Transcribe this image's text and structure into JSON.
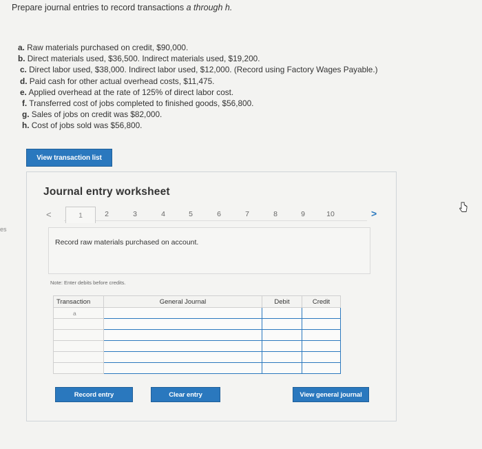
{
  "prompt": {
    "text": "Prepare journal entries to record transactions",
    "range": "a through h."
  },
  "left_edge_text": "es",
  "transactions": [
    {
      "letter": "a.",
      "text": "Raw materials purchased on credit, $90,000."
    },
    {
      "letter": "b.",
      "text": "Direct materials used, $36,500. Indirect materials used, $19,200."
    },
    {
      "letter": "c.",
      "text": "Direct labor used, $38,000. Indirect labor used, $12,000. (Record using Factory Wages Payable.)"
    },
    {
      "letter": "d.",
      "text": "Paid cash for other actual overhead costs, $11,475."
    },
    {
      "letter": "e.",
      "text": "Applied overhead at the rate of 125% of direct labor cost."
    },
    {
      "letter": "f.",
      "text": "Transferred cost of jobs completed to finished goods, $56,800."
    },
    {
      "letter": "g.",
      "text": "Sales of jobs on credit was $82,000."
    },
    {
      "letter": "h.",
      "text": "Cost of jobs sold was $56,800."
    }
  ],
  "buttons": {
    "view_transaction_list": "View transaction list",
    "record_entry": "Record entry",
    "clear_entry": "Clear entry",
    "view_general_journal": "View general journal"
  },
  "worksheet": {
    "title": "Journal entry worksheet",
    "nav_prev": "<",
    "nav_next": ">",
    "pages": [
      "1",
      "2",
      "3",
      "4",
      "5",
      "6",
      "7",
      "8",
      "9",
      "10"
    ],
    "active_page": "1",
    "description": "Record raw materials purchased on account.",
    "note": "Note: Enter debits before credits."
  },
  "journal_table": {
    "headers": {
      "transaction": "Transaction",
      "general_journal": "General Journal",
      "debit": "Debit",
      "credit": "Credit"
    },
    "rows": [
      {
        "transaction": "a",
        "account": "",
        "debit": "",
        "credit": ""
      },
      {
        "transaction": "",
        "account": "",
        "debit": "",
        "credit": ""
      },
      {
        "transaction": "",
        "account": "",
        "debit": "",
        "credit": ""
      },
      {
        "transaction": "",
        "account": "",
        "debit": "",
        "credit": ""
      },
      {
        "transaction": "",
        "account": "",
        "debit": "",
        "credit": ""
      },
      {
        "transaction": "",
        "account": "",
        "debit": "",
        "credit": ""
      }
    ]
  },
  "colors": {
    "accent": "#2a78be",
    "background": "#f3f3f1"
  },
  "icons": {
    "cursor": "pointer-cursor-icon"
  }
}
